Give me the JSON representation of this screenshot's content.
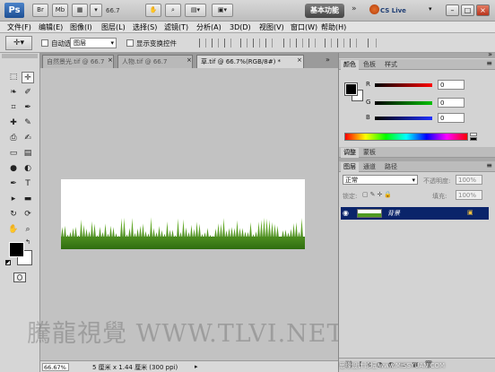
{
  "app": {
    "logo": "Ps",
    "title_icons": [
      "Br",
      "Mb",
      "▦",
      "⨯",
      "✋",
      "⌕"
    ],
    "zoom_display": "66.7",
    "workspace_label": "基本功能",
    "workspace_more": "»",
    "cs_live_label": "CS Live",
    "window_buttons": [
      "–",
      "□",
      "×"
    ]
  },
  "menubar": {
    "items": [
      "文件(F)",
      "编辑(E)",
      "图像(I)",
      "图层(L)",
      "选择(S)",
      "滤镜(T)",
      "分析(A)",
      "3D(D)",
      "视图(V)",
      "窗口(W)",
      "帮助(H)"
    ]
  },
  "options_bar": {
    "auto_select_label": "自动选择:",
    "auto_select_value": "图层",
    "show_transform_label": "显示变换控件"
  },
  "toolbox": {
    "tools": [
      {
        "icon": "marquee-icon",
        "glyph": "⬚"
      },
      {
        "icon": "move-icon",
        "glyph": "✛"
      },
      {
        "icon": "lasso-icon",
        "glyph": "❧"
      },
      {
        "icon": "quick-select-icon",
        "glyph": "✐"
      },
      {
        "icon": "crop-icon",
        "glyph": "⌗"
      },
      {
        "icon": "eyedropper-icon",
        "glyph": "✒"
      },
      {
        "icon": "healing-icon",
        "glyph": "✚"
      },
      {
        "icon": "brush-icon",
        "glyph": "✎"
      },
      {
        "icon": "stamp-icon",
        "glyph": "⎙"
      },
      {
        "icon": "history-brush-icon",
        "glyph": "✍"
      },
      {
        "icon": "eraser-icon",
        "glyph": "▭"
      },
      {
        "icon": "gradient-icon",
        "glyph": "▤"
      },
      {
        "icon": "blur-icon",
        "glyph": "●"
      },
      {
        "icon": "dodge-icon",
        "glyph": "◐"
      },
      {
        "icon": "pen-icon",
        "glyph": "✒"
      },
      {
        "icon": "type-icon",
        "glyph": "T"
      },
      {
        "icon": "path-select-icon",
        "glyph": "▸"
      },
      {
        "icon": "shape-icon",
        "glyph": "▬"
      },
      {
        "icon": "3d-rotate-icon",
        "glyph": "↻"
      },
      {
        "icon": "3d-orbit-icon",
        "glyph": "⟳"
      },
      {
        "icon": "hand-icon",
        "glyph": "✋"
      },
      {
        "icon": "zoom-icon",
        "glyph": "⌕"
      }
    ]
  },
  "documents": {
    "tabs": [
      {
        "label": "自然景光.tif @ 66.7",
        "close": "×",
        "active": false
      },
      {
        "label": "人物.tif @ 66.7",
        "close": "×",
        "active": false
      },
      {
        "label": "草.tif @ 66.7%(RGB/8#) *",
        "close": "×",
        "active": true
      }
    ]
  },
  "status_bar": {
    "zoom": "66.67%",
    "doc_info": "5 厘米 x 1.44 厘米 (300 ppi)"
  },
  "watermark": {
    "text": "騰龍視覺 WWW.TLVI.NET",
    "corner": "思缘设计论坛 www.MISSYUAN.COM"
  },
  "color_panel": {
    "tabs": [
      "颜色",
      "色板",
      "样式"
    ],
    "channels": [
      {
        "label": "R",
        "value": "0",
        "gradient": [
          "#000000",
          "#ff0000"
        ]
      },
      {
        "label": "G",
        "value": "0",
        "gradient": [
          "#000000",
          "#00c000"
        ]
      },
      {
        "label": "B",
        "value": "0",
        "gradient": [
          "#000000",
          "#2030ff"
        ]
      }
    ]
  },
  "adjust_panel": {
    "tabs": [
      "调整",
      "蒙板"
    ]
  },
  "layers_panel": {
    "tabs": [
      "图层",
      "通道",
      "路径"
    ],
    "blend_mode": "正常",
    "opacity_label": "不透明度:",
    "opacity_value": "100%",
    "lock_label": "锁定:",
    "fill_label": "填充:",
    "fill_value": "100%",
    "layers": [
      {
        "name": "背景",
        "visible": true,
        "locked": true,
        "selected": true
      }
    ]
  },
  "colors": {
    "layer_selected": "#0a246a",
    "grass_dark": "#2f6d10",
    "grass_light": "#7cc23a",
    "canvas_bg": "#c2c2c2"
  }
}
